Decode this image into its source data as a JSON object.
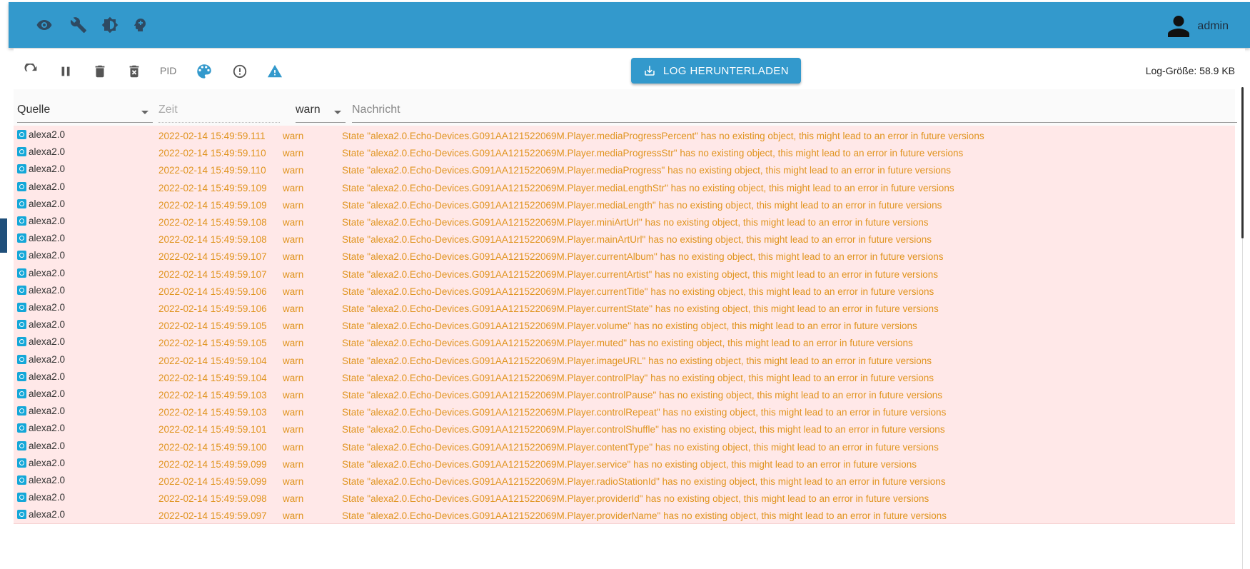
{
  "user": {
    "name": "admin"
  },
  "toolbar": {
    "pid_label": "PID",
    "download_label": "LOG HERUNTERLADEN",
    "log_size": "Log-Größe: 58.9 KB"
  },
  "filters": {
    "source": "Quelle",
    "time_placeholder": "Zeit",
    "level": "warn",
    "message_placeholder": "Nachricht"
  },
  "colors": {
    "accent": "#3399cc",
    "warn_text": "#e0941f",
    "row_bg": "#ffe8e8"
  },
  "rows": [
    {
      "src": "alexa2.0",
      "time": "2022-02-14 15:49:59.111",
      "level": "warn",
      "msg": "State \"alexa2.0.Echo-Devices.G091AA121522069M.Player.mediaProgressPercent\" has no existing object, this might lead to an error in future versions"
    },
    {
      "src": "alexa2.0",
      "time": "2022-02-14 15:49:59.110",
      "level": "warn",
      "msg": "State \"alexa2.0.Echo-Devices.G091AA121522069M.Player.mediaProgressStr\" has no existing object, this might lead to an error in future versions"
    },
    {
      "src": "alexa2.0",
      "time": "2022-02-14 15:49:59.110",
      "level": "warn",
      "msg": "State \"alexa2.0.Echo-Devices.G091AA121522069M.Player.mediaProgress\" has no existing object, this might lead to an error in future versions"
    },
    {
      "src": "alexa2.0",
      "time": "2022-02-14 15:49:59.109",
      "level": "warn",
      "msg": "State \"alexa2.0.Echo-Devices.G091AA121522069M.Player.mediaLengthStr\" has no existing object, this might lead to an error in future versions"
    },
    {
      "src": "alexa2.0",
      "time": "2022-02-14 15:49:59.109",
      "level": "warn",
      "msg": "State \"alexa2.0.Echo-Devices.G091AA121522069M.Player.mediaLength\" has no existing object, this might lead to an error in future versions"
    },
    {
      "src": "alexa2.0",
      "time": "2022-02-14 15:49:59.108",
      "level": "warn",
      "msg": "State \"alexa2.0.Echo-Devices.G091AA121522069M.Player.miniArtUrl\" has no existing object, this might lead to an error in future versions"
    },
    {
      "src": "alexa2.0",
      "time": "2022-02-14 15:49:59.108",
      "level": "warn",
      "msg": "State \"alexa2.0.Echo-Devices.G091AA121522069M.Player.mainArtUrl\" has no existing object, this might lead to an error in future versions"
    },
    {
      "src": "alexa2.0",
      "time": "2022-02-14 15:49:59.107",
      "level": "warn",
      "msg": "State \"alexa2.0.Echo-Devices.G091AA121522069M.Player.currentAlbum\" has no existing object, this might lead to an error in future versions"
    },
    {
      "src": "alexa2.0",
      "time": "2022-02-14 15:49:59.107",
      "level": "warn",
      "msg": "State \"alexa2.0.Echo-Devices.G091AA121522069M.Player.currentArtist\" has no existing object, this might lead to an error in future versions"
    },
    {
      "src": "alexa2.0",
      "time": "2022-02-14 15:49:59.106",
      "level": "warn",
      "msg": "State \"alexa2.0.Echo-Devices.G091AA121522069M.Player.currentTitle\" has no existing object, this might lead to an error in future versions"
    },
    {
      "src": "alexa2.0",
      "time": "2022-02-14 15:49:59.106",
      "level": "warn",
      "msg": "State \"alexa2.0.Echo-Devices.G091AA121522069M.Player.currentState\" has no existing object, this might lead to an error in future versions"
    },
    {
      "src": "alexa2.0",
      "time": "2022-02-14 15:49:59.105",
      "level": "warn",
      "msg": "State \"alexa2.0.Echo-Devices.G091AA121522069M.Player.volume\" has no existing object, this might lead to an error in future versions"
    },
    {
      "src": "alexa2.0",
      "time": "2022-02-14 15:49:59.105",
      "level": "warn",
      "msg": "State \"alexa2.0.Echo-Devices.G091AA121522069M.Player.muted\" has no existing object, this might lead to an error in future versions"
    },
    {
      "src": "alexa2.0",
      "time": "2022-02-14 15:49:59.104",
      "level": "warn",
      "msg": "State \"alexa2.0.Echo-Devices.G091AA121522069M.Player.imageURL\" has no existing object, this might lead to an error in future versions"
    },
    {
      "src": "alexa2.0",
      "time": "2022-02-14 15:49:59.104",
      "level": "warn",
      "msg": "State \"alexa2.0.Echo-Devices.G091AA121522069M.Player.controlPlay\" has no existing object, this might lead to an error in future versions"
    },
    {
      "src": "alexa2.0",
      "time": "2022-02-14 15:49:59.103",
      "level": "warn",
      "msg": "State \"alexa2.0.Echo-Devices.G091AA121522069M.Player.controlPause\" has no existing object, this might lead to an error in future versions"
    },
    {
      "src": "alexa2.0",
      "time": "2022-02-14 15:49:59.103",
      "level": "warn",
      "msg": "State \"alexa2.0.Echo-Devices.G091AA121522069M.Player.controlRepeat\" has no existing object, this might lead to an error in future versions"
    },
    {
      "src": "alexa2.0",
      "time": "2022-02-14 15:49:59.101",
      "level": "warn",
      "msg": "State \"alexa2.0.Echo-Devices.G091AA121522069M.Player.controlShuffle\" has no existing object, this might lead to an error in future versions"
    },
    {
      "src": "alexa2.0",
      "time": "2022-02-14 15:49:59.100",
      "level": "warn",
      "msg": "State \"alexa2.0.Echo-Devices.G091AA121522069M.Player.contentType\" has no existing object, this might lead to an error in future versions"
    },
    {
      "src": "alexa2.0",
      "time": "2022-02-14 15:49:59.099",
      "level": "warn",
      "msg": "State \"alexa2.0.Echo-Devices.G091AA121522069M.Player.service\" has no existing object, this might lead to an error in future versions"
    },
    {
      "src": "alexa2.0",
      "time": "2022-02-14 15:49:59.099",
      "level": "warn",
      "msg": "State \"alexa2.0.Echo-Devices.G091AA121522069M.Player.radioStationId\" has no existing object, this might lead to an error in future versions"
    },
    {
      "src": "alexa2.0",
      "time": "2022-02-14 15:49:59.098",
      "level": "warn",
      "msg": "State \"alexa2.0.Echo-Devices.G091AA121522069M.Player.providerId\" has no existing object, this might lead to an error in future versions"
    },
    {
      "src": "alexa2.0",
      "time": "2022-02-14 15:49:59.097",
      "level": "warn",
      "msg": "State \"alexa2.0.Echo-Devices.G091AA121522069M.Player.providerName\" has no existing object, this might lead to an error in future versions"
    }
  ]
}
